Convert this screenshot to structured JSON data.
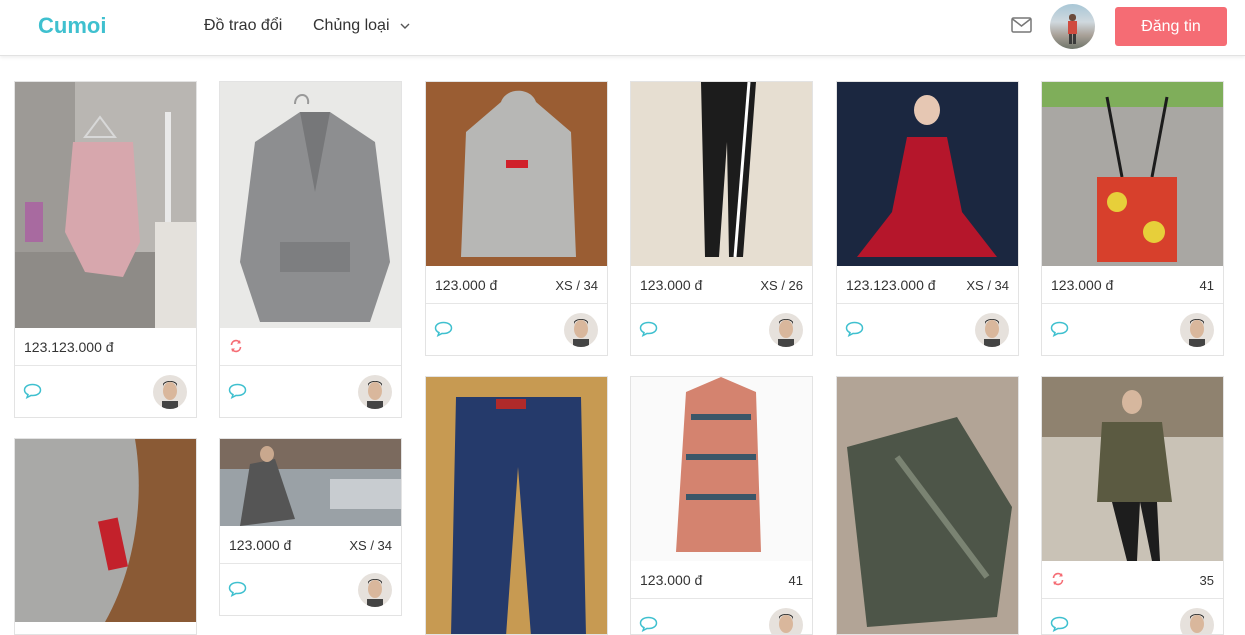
{
  "header": {
    "logo": "Cumoi",
    "nav": {
      "exchange": "Đồ trao đổi",
      "category": "Chủng loại"
    },
    "post_button": "Đăng tin"
  },
  "colors": {
    "brand": "#3fc0cf",
    "accent_button": "#f56c74",
    "chat_icon": "#3fc0cf",
    "swap_icon": "#f56c74"
  },
  "icons": {
    "mail": "mail-icon",
    "chevron": "chevron-down-icon",
    "chat": "chat-bubble-icon",
    "swap": "swap-icon"
  },
  "products": [
    {
      "price": "123.123.000 đ",
      "size": ""
    },
    {
      "price": "",
      "size": "",
      "swap": true
    },
    {
      "price": "123.000 đ",
      "size": "XS / 34"
    },
    {
      "price": "123.000 đ",
      "size": "XS / 26"
    },
    {
      "price": "123.123.000 đ",
      "size": "XS / 34"
    },
    {
      "price": "123.000 đ",
      "size": "41"
    },
    {
      "price": "",
      "size": ""
    },
    {
      "price": "123.000 đ",
      "size": "XS / 34"
    },
    {
      "price": "",
      "size": ""
    },
    {
      "price": "123.000 đ",
      "size": "41"
    },
    {
      "price": "",
      "size": ""
    },
    {
      "price": "",
      "size": "35",
      "swap": true
    }
  ]
}
